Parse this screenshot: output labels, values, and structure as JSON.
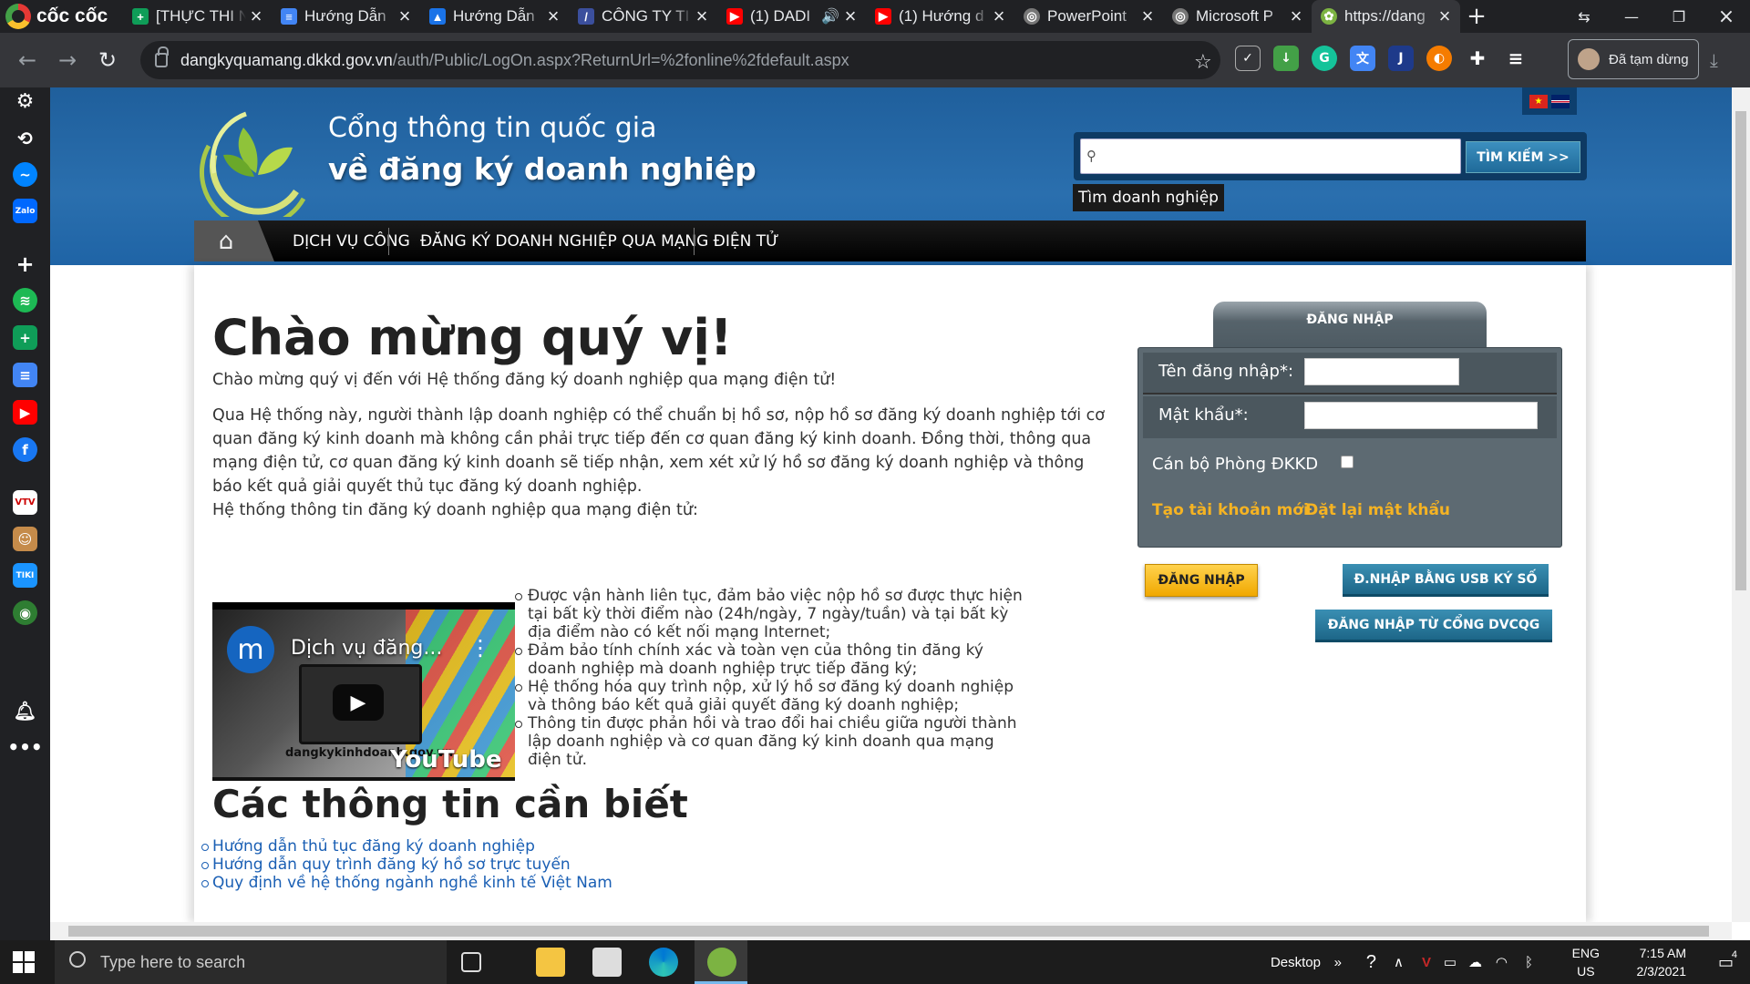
{
  "browser": {
    "brand": "cốc cốc",
    "tabs": [
      {
        "title": "[THỰC THI N",
        "icon": "sheets-plus-icon",
        "color": "#0f9d58",
        "active": false
      },
      {
        "title": "Hướng Dẫn",
        "icon": "docs-icon",
        "color": "#4285f4",
        "active": false
      },
      {
        "title": "Hướng Dẫn",
        "icon": "drive-icon",
        "color": "#1a73e8",
        "active": false
      },
      {
        "title": "CÔNG TY TI",
        "icon": "tracking-icon",
        "color": "#3b4f9d",
        "active": false
      },
      {
        "title": "(1) DADI",
        "icon": "youtube-icon",
        "color": "#ff0000",
        "active": false
      },
      {
        "title": "(1) Hướng d",
        "icon": "youtube-icon",
        "color": "#ff0000",
        "active": false
      },
      {
        "title": "PowerPoint",
        "icon": "globe-icon",
        "color": "#777777",
        "active": false
      },
      {
        "title": "Microsoft P",
        "icon": "globe-icon",
        "color": "#777777",
        "active": false
      },
      {
        "title": "https://dang",
        "icon": "dkkd-leaf-icon",
        "color": "#7cb342",
        "active": true
      }
    ],
    "url_host": "dangkyquamang.dkkd.gov.vn",
    "url_path": "/auth/Public/LogOn.aspx?ReturnUrl=%2fonline%2fdefault.aspx",
    "profile_label": "Đã tạm dừng"
  },
  "header": {
    "line1": "Cổng thông tin quốc gia",
    "line2": "về đăng ký doanh nghiệp",
    "search_button": "TÌM KIẾM >>",
    "search_tooltip": "Tìm doanh nghiệp",
    "nav": [
      "DỊCH VỤ CÔNG",
      "ĐĂNG KÝ DOANH NGHIỆP QUA MẠNG ĐIỆN TỬ"
    ]
  },
  "main": {
    "title": "Chào mừng quý vị!",
    "intro": "Chào mừng quý vị đến với Hệ thống đăng ký doanh nghiệp qua mạng điện tử!",
    "body": "Qua Hệ thống này, người thành lập doanh nghiệp có thể chuẩn bị hồ sơ, nộp hồ sơ đăng ký doanh nghiệp tới cơ quan đăng ký kinh doanh mà không cần phải trực tiếp đến cơ quan đăng ký kinh doanh. Đồng thời, thông qua mạng điện tử, cơ quan đăng ký kinh doanh sẽ tiếp nhận, xem xét xử lý hồ sơ đăng ký doanh nghiệp và thông báo kết quả giải quyết thủ tục đăng ký doanh nghiệp.",
    "system_label": "Hệ thống thông tin đăng ký doanh nghiệp qua mạng điện tử:",
    "video": {
      "channel_letter": "m",
      "title": "Dịch vụ đăng...",
      "caption": "dangkykinhdoanh.gov.vn",
      "platform": "YouTube"
    },
    "features": [
      "Được vận hành liên tục, đảm bảo việc nộp hồ sơ được thực hiện tại bất kỳ thời điểm nào (24h/ngày, 7 ngày/tuần) và tại bất kỳ địa điểm nào có kết nối mạng Internet;",
      "Đảm bảo tính chính xác và toàn vẹn của thông tin đăng ký doanh nghiệp mà doanh nghiệp trực tiếp đăng ký;",
      "Hệ thống hóa quy trình nộp, xử lý hồ sơ đăng ký doanh nghiệp và thông báo kết quả giải quyết đăng ký doanh nghiệp;",
      "Thông tin được phản hồi và trao đổi hai chiều giữa người thành lập doanh nghiệp và cơ quan đăng ký kinh doanh qua mạng điện tử."
    ],
    "info_title": "Các thông tin cần biết",
    "links": [
      "Hướng dẫn thủ tục đăng ký doanh nghiệp",
      "Hướng dẫn quy trình đăng ký hồ sơ trực tuyến",
      "Quy định về hệ thống ngành nghề kinh tế Việt Nam"
    ]
  },
  "login": {
    "tab": "ĐĂNG NHẬP",
    "username_label": "Tên đăng nhập*:",
    "password_label": "Mật khẩu*:",
    "officer_label": "Cán bộ Phòng ĐKKD",
    "create_account": "Tạo tài khoản mới",
    "reset_password": "Đặt lại mật khẩu",
    "login_button": "ĐĂNG NHẬP",
    "usb_button": "Đ.NHẬP BẰNG USB KÝ SỐ",
    "dvc_button": "ĐĂNG NHẬP TỪ CỔNG DVCQG"
  },
  "taskbar": {
    "search_placeholder": "Type here to search",
    "desktop_label": "Desktop",
    "lang": "ENG",
    "region": "US",
    "time": "7:15 AM",
    "date": "2/3/2021",
    "notif_count": "4"
  },
  "colors": {
    "header_blue": "#1f64a6",
    "nav_black": "#000000",
    "login_panel": "#5d6a72",
    "link_yellow": "#f5b323",
    "button_yellow": "#f0a800",
    "button_blue": "#1d6688",
    "link_blue": "#1a5fb4"
  }
}
